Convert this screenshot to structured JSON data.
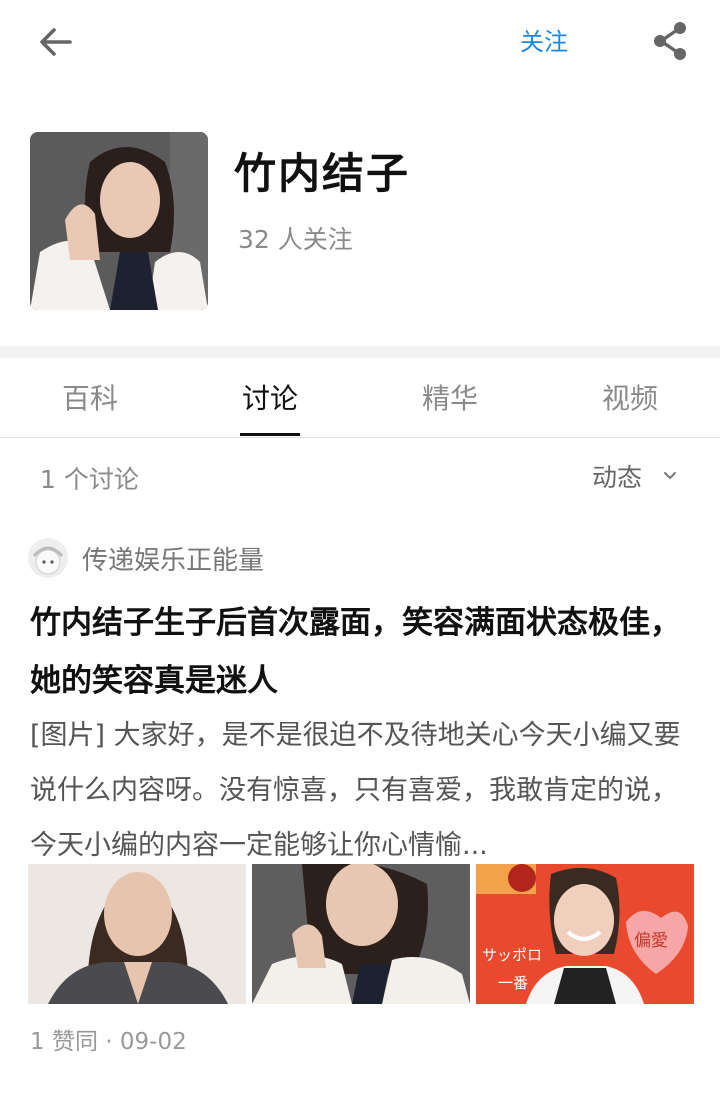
{
  "topbar": {
    "back_icon": "arrow-left-icon",
    "follow_label": "关注",
    "share_icon": "share-icon",
    "accent": "#1a87e0"
  },
  "profile": {
    "name": "竹内结子",
    "followers": "32 人关注"
  },
  "tabs": [
    {
      "label": "百科",
      "active": false
    },
    {
      "label": "讨论",
      "active": true
    },
    {
      "label": "精华",
      "active": false
    },
    {
      "label": "视频",
      "active": false
    }
  ],
  "discussion": {
    "count": "1 个讨论",
    "sort_label": "动态",
    "sort_icon": "chevron-down-icon"
  },
  "post": {
    "author": "传递娱乐正能量",
    "title": "竹内结子生子后首次露面，笑容满面状态极佳，她的笑容真是迷人",
    "excerpt": "[图片] 大家好，是不是很迫不及待地关心今天小编又要说什么内容呀。没有惊喜，只有喜爱，我敢肯定的说，今天小编的内容一定能够让你心情愉...",
    "meta": "1 赞同 · 09-02",
    "thumb3_text_a": "サッポロ",
    "thumb3_text_b": "一番",
    "thumb3_text_c": "偏愛"
  }
}
